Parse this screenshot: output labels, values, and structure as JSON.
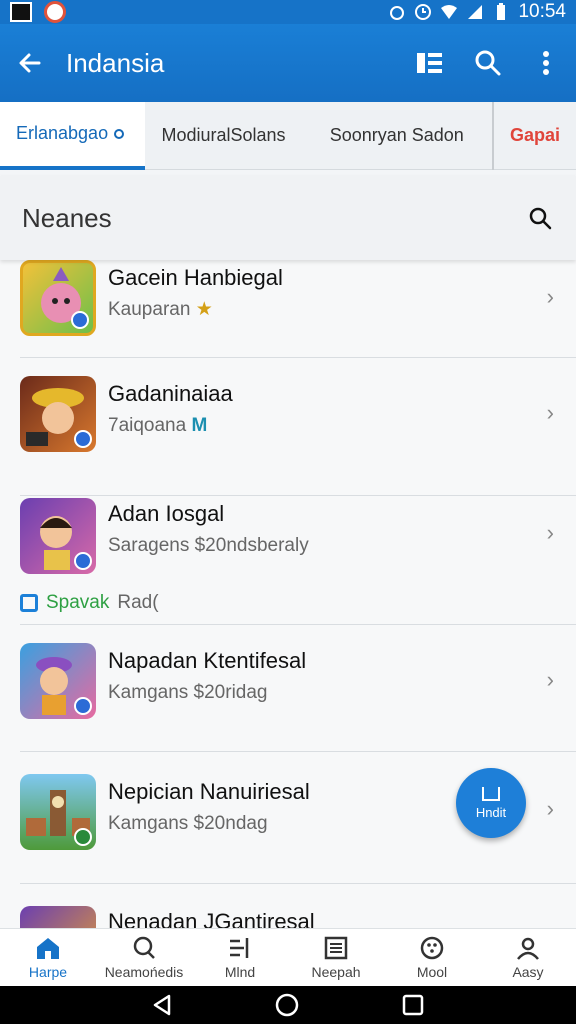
{
  "status_bar": {
    "time": "10:54"
  },
  "app_bar": {
    "title": "Indansia"
  },
  "tabs": [
    {
      "label": "Erlanabgao"
    },
    {
      "label": "ModiuralSolans"
    },
    {
      "label": "Soonryan Sadon"
    },
    {
      "label": "Gapai"
    }
  ],
  "section": {
    "title": "Neanes"
  },
  "list": {
    "items": [
      {
        "title": "Gacein Hanbiegal",
        "subtitle": "Kauparan"
      },
      {
        "title": "Gadaninaiaa",
        "subtitle": "7aiqoana"
      },
      {
        "title": "Adan Iosgal",
        "subtitle": "Saragens $20ndsberaly"
      },
      {
        "title": "Napadan Ktentifesal",
        "subtitle": "Kamgans $20ridag"
      },
      {
        "title": "Nepician Nanuiriesal",
        "subtitle": "Kamgans $20ndag"
      },
      {
        "title": "Nenadan JGantiresal",
        "subtitle": ""
      }
    ],
    "tagline": {
      "highlight": "Spavak",
      "rest": "Rad("
    }
  },
  "fab": {
    "label": "Hndit"
  },
  "bottom_nav": [
    {
      "label": "Harpe",
      "icon": "home-icon"
    },
    {
      "label": "Neamońedis",
      "icon": "search-icon"
    },
    {
      "label": "Mlnd",
      "icon": "mind-icon"
    },
    {
      "label": "Neepah",
      "icon": "list-icon"
    },
    {
      "label": "Mool",
      "icon": "dots-circle-icon"
    },
    {
      "label": "Aasy",
      "icon": "person-icon"
    }
  ],
  "colors": {
    "primary": "#1673c8",
    "accent_red": "#e0453b",
    "tag_green": "#2ea043"
  }
}
